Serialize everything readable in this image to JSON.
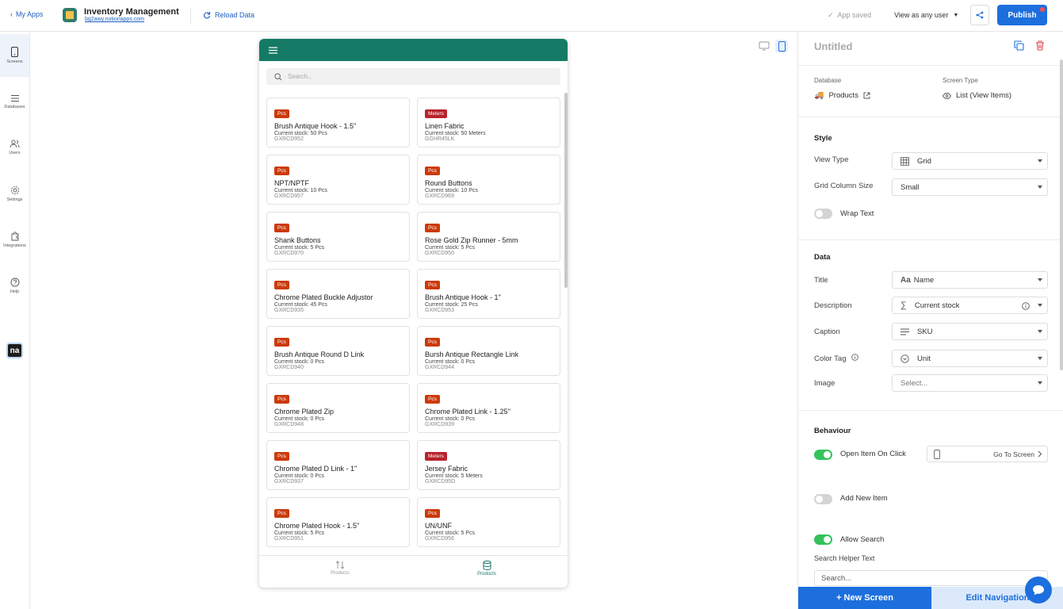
{
  "topbar": {
    "back_label": "My Apps",
    "app_title": "Inventory Management",
    "app_url": "bg2awy.notionapps.com",
    "reload_label": "Reload Data",
    "saved_label": "App saved",
    "view_as_label": "View as any user",
    "publish_label": "Publish"
  },
  "leftnav": [
    "Screens",
    "Databases",
    "Users",
    "Settings",
    "Integrations",
    "Help"
  ],
  "leftnav_logo": "na",
  "phone": {
    "search_placeholder": "Search...",
    "cards": [
      {
        "tag": "Pcs",
        "title": "Brush Antique Hook - 1.5''",
        "stock": "Current stock: 50 Pcs",
        "sku": "GXRCD952"
      },
      {
        "tag": "Meters",
        "title": "Linen Fabric",
        "stock": "Current stock: 50 Meters",
        "sku": "GGHR45LK"
      },
      {
        "tag": "Pcs",
        "title": "NPT/NPTF",
        "stock": "Current stock: 10 Pcs",
        "sku": "GXRCD957"
      },
      {
        "tag": "Pcs",
        "title": "Round Buttons",
        "stock": "Current stock: 10 Pcs",
        "sku": "GXRCD969"
      },
      {
        "tag": "Pcs",
        "title": "Shank Buttons",
        "stock": "Current stock: 5 Pcs",
        "sku": "GXRCD970"
      },
      {
        "tag": "Pcs",
        "title": "Rose Gold Zip Runner - 5mm",
        "stock": "Current stock: 5 Pcs",
        "sku": "GXRCD950"
      },
      {
        "tag": "Pcs",
        "title": "Chrome Plated Buckle Adjustor",
        "stock": "Current stock: 45 Pcs",
        "sku": "GXRCD935"
      },
      {
        "tag": "Pcs",
        "title": "Brush Antique Hook - 1''",
        "stock": "Current stock: 25 Pcs",
        "sku": "GXRCD953"
      },
      {
        "tag": "Pcs",
        "title": "Brush Antique Round D Link",
        "stock": "Current stock: 0 Pcs",
        "sku": "GXRCD940"
      },
      {
        "tag": "Pcs",
        "title": "Bursh Antique Rectangle Link",
        "stock": "Current stock: 0 Pcs",
        "sku": "GXRCD944"
      },
      {
        "tag": "Pcs",
        "title": "Chrome Plated Zip",
        "stock": "Current stock: 0 Pcs",
        "sku": "GXRCD948"
      },
      {
        "tag": "Pcs",
        "title": "Chrome Plated Link - 1.25''",
        "stock": "Current stock: 0 Pcs",
        "sku": "GXRCD939"
      },
      {
        "tag": "Pcs",
        "title": "Chrome Plated D Link - 1''",
        "stock": "Current stock: 0 Pcs",
        "sku": "GXRCD937"
      },
      {
        "tag": "Meters",
        "title": "Jersey Fabric",
        "stock": "Current stock: 5 Meters",
        "sku": "GXRCD95D"
      },
      {
        "tag": "Pcs",
        "title": "Chrome Plated Hook - 1.5''",
        "stock": "Current stock: 5 Pcs",
        "sku": "GXRCD951"
      },
      {
        "tag": "Pcs",
        "title": "UN/UNF",
        "stock": "Current stock: 5 Pcs",
        "sku": "GXRCD956"
      }
    ],
    "tabs": [
      "Products",
      "Products"
    ]
  },
  "panel": {
    "title": "Untitled",
    "database_label": "Database",
    "database_value": "Products",
    "screen_type_label": "Screen Type",
    "screen_type_value": "List (View Items)",
    "style_title": "Style",
    "view_type_label": "View Type",
    "view_type_value": "Grid",
    "grid_col_label": "Grid Column Size",
    "grid_col_value": "Small",
    "wrap_text_label": "Wrap Text",
    "data_title": "Data",
    "title_label": "Title",
    "title_value": "Name",
    "description_label": "Description",
    "description_value": "Current stock",
    "caption_label": "Caption",
    "caption_value": "SKU",
    "color_tag_label": "Color Tag",
    "color_tag_value": "Unit",
    "image_label": "Image",
    "image_value": "Select...",
    "behaviour_title": "Behaviour",
    "open_item_label": "Open Item On Click",
    "goto_label": "Go To Screen",
    "add_new_label": "Add New Item",
    "allow_search_label": "Allow Search",
    "search_helper_label": "Search Helper Text",
    "search_helper_value": "Search...",
    "new_screen_label": "+ New Screen",
    "edit_nav_label": "Edit Navigation"
  },
  "colors": {
    "primary": "#1d6fde",
    "app_header": "#147a65",
    "tag_pcs": "#cc3a0a",
    "tag_meters": "#b8232c",
    "toggle_on": "#34c25b"
  }
}
